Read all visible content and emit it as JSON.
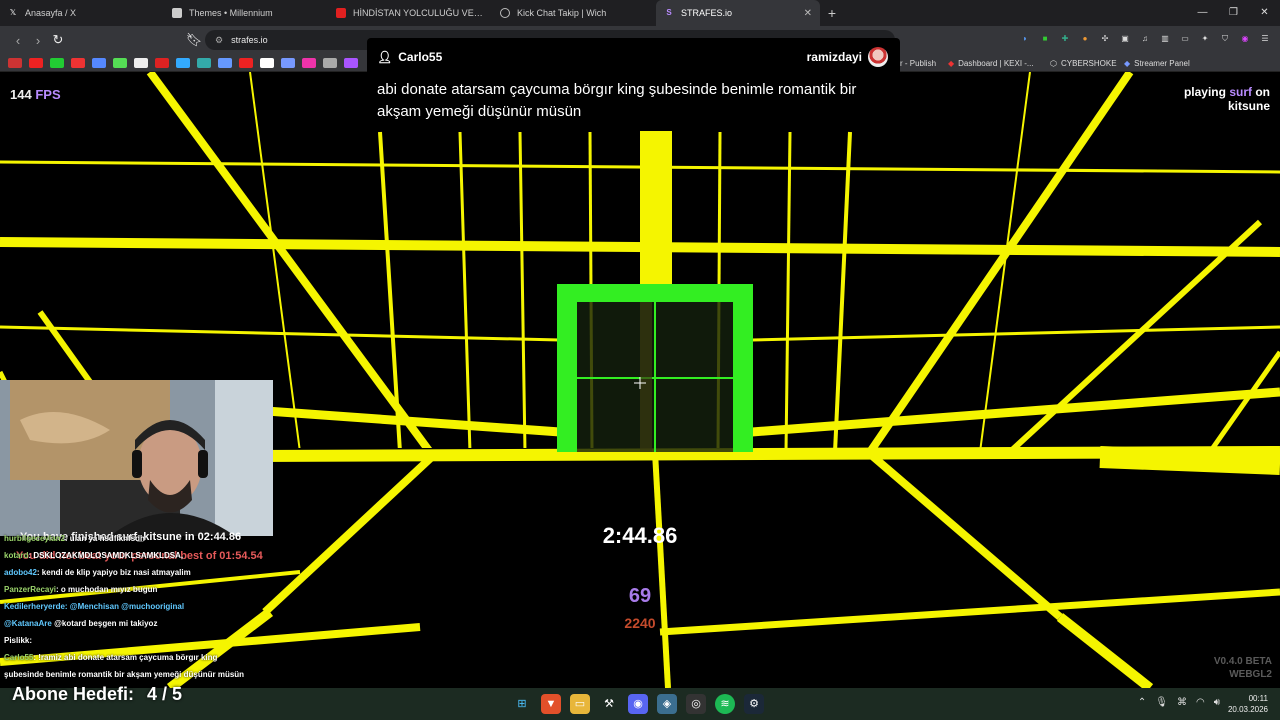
{
  "browser": {
    "tabs": [
      {
        "label": "Anasayfa / X",
        "icon": "x-logo-icon"
      },
      {
        "label": "Themes • Millennium",
        "icon": "millennium-icon"
      },
      {
        "label": "HİNDİSTAN YOLCULUĞU VE HİNDİSTAN",
        "icon": "youtube-icon"
      },
      {
        "label": "Kick Chat Takip | Wich",
        "icon": "kick-icon"
      },
      {
        "label": "STRAFES.io",
        "icon": "strafes-icon",
        "active": true
      }
    ],
    "url": "strafes.io",
    "bookmarks": [
      "Publish",
      "Dashboard | KEXI -...",
      "CYBERSHOKE",
      "Streamer Panel"
    ],
    "bookmark_prefix": "r - Publish"
  },
  "popup": {
    "sender": "Carlo55",
    "receiver": "ramizdayi",
    "message": "abi donate atarsam çaycuma börgır king şubesinde benimle romantik bir akşam yemeği düşünür müsün"
  },
  "hud": {
    "fps_value": "144",
    "fps_unit": "FPS",
    "playing_prefix": "playing",
    "playing_mode": "surf",
    "playing_suffix": "on",
    "map_name": "kitsune",
    "timer": "2:44.86",
    "speed": "69",
    "speed_secondary": "2240",
    "version": "V0.4.0 BETA",
    "renderer": "WEBGL2",
    "finished": "You have finished surf_kitsune in 02:44.86",
    "personal_best": "You did not beat your personal best of 01:54.54"
  },
  "chat": [
    {
      "user": "hurbilgeceylan2",
      "text": ": ulan ya hsdfikhfsdh"
    },
    {
      "user": "kotard",
      "text": ": DSKLOZAKMDLOSAMDKLSAMKLDSA,"
    },
    {
      "user": "adobo42",
      "text": ": kendi de klip yapiyo biz nasi atmayalim"
    },
    {
      "user": "PanzerRecayi",
      "text": ": o muchodan mıyız bugun"
    },
    {
      "user": "Kedilerheryerde",
      "text": ": @Menchisan @muchooriginal"
    },
    {
      "user": "@KatanaAre",
      "text": "@kotard beşgen mi takiyoz"
    },
    {
      "user": "Pislikk",
      "text": ":"
    },
    {
      "user": "Carlo55",
      "text": ": !ramiz abi donate atarsam çaycuma börgır king"
    },
    {
      "user": "",
      "text": "şubesinde benimle romantik bir akşam yemeği düşünür müsün"
    }
  ],
  "goal": {
    "label": "Abone Hedefi:",
    "value": "4 / 5"
  },
  "taskbar": {
    "time": "00:11",
    "date": "20.03.2026"
  },
  "colors": {
    "grid": "#f5f500",
    "door": "#33ee22",
    "accent": "#b98cff"
  }
}
